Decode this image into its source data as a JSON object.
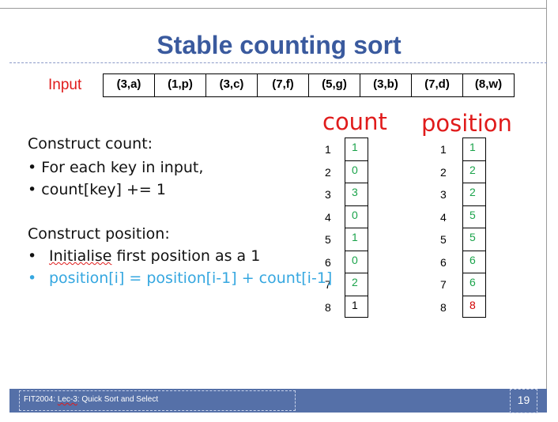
{
  "title": "Stable counting sort",
  "input": {
    "label": "Input",
    "cells": [
      "(3,a)",
      "(1,p)",
      "(3,c)",
      "(7,f)",
      "(5,g)",
      "(3,b)",
      "(7,d)",
      "(8,w)"
    ]
  },
  "count": {
    "header": "count",
    "indices": [
      "1",
      "2",
      "3",
      "4",
      "5",
      "6",
      "7",
      "8"
    ],
    "values": [
      "1",
      "0",
      "3",
      "0",
      "1",
      "0",
      "2",
      "1"
    ]
  },
  "position": {
    "header": "position",
    "indices": [
      "1",
      "2",
      "3",
      "4",
      "5",
      "6",
      "7",
      "8"
    ],
    "values": [
      "1",
      "2",
      "2",
      "5",
      "5",
      "6",
      "6",
      "8"
    ]
  },
  "body": {
    "line1": "Construct count:",
    "line2": "For each key in input,",
    "line3": "count[key] += 1",
    "line4": "Construct position:",
    "line5_a": "Initialise",
    "line5_b": " first position as a 1",
    "line6": "position[i] = position[i-1] + count[i-1]",
    "bullet": "•"
  },
  "colors": {
    "title": "#3a5a9e",
    "red": "#e01b1b",
    "green": "#1aa34a",
    "blue_text": "#35a7e0",
    "footer": "#5570a8"
  },
  "footer": {
    "course_a": "FIT2004: ",
    "course_b": "Lec-3",
    "course_c": ": Quick Sort and Select",
    "page": "19"
  }
}
